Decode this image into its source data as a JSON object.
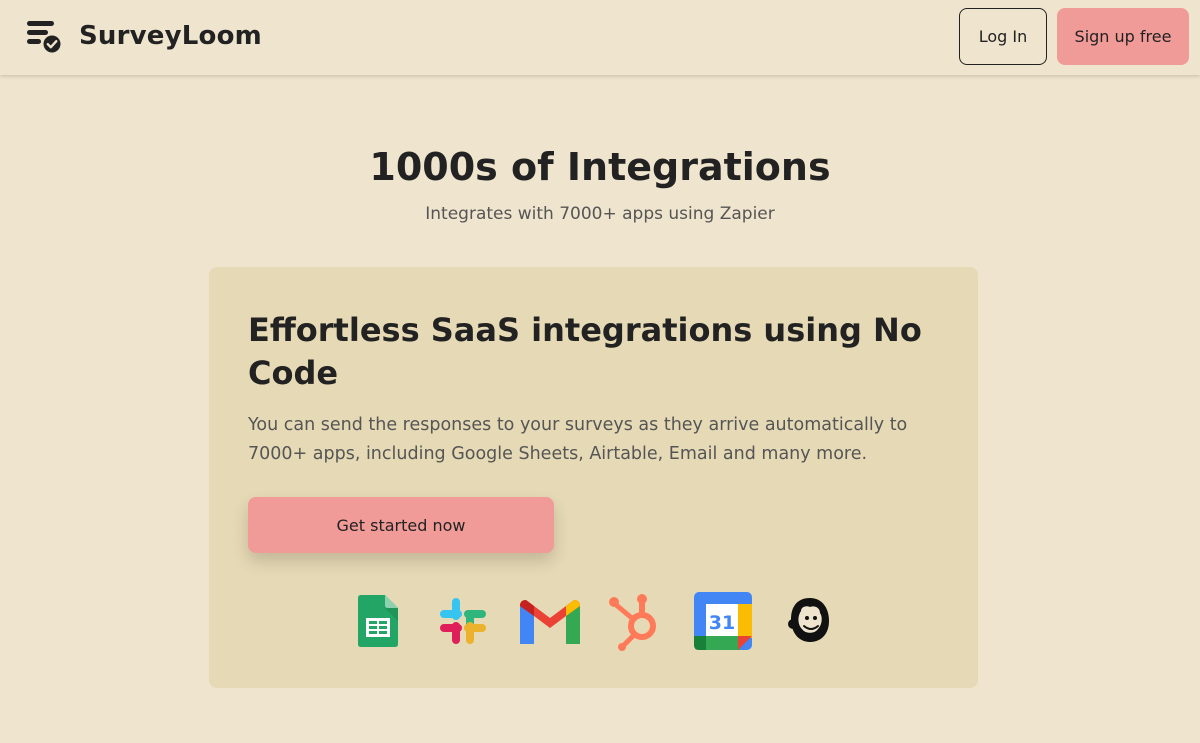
{
  "header": {
    "brand": "SurveyLoom",
    "logo_icon": "checklist-check-icon",
    "login_label": "Log In",
    "signup_label": "Sign up free"
  },
  "hero": {
    "title": "1000s of Integrations",
    "subtitle": "Integrates with 7000+ apps using Zapier"
  },
  "card": {
    "title": "Effortless SaaS integrations using No Code",
    "description": "You can send the responses to your surveys as they arrive automatically to 7000+ apps, including Google Sheets, Airtable, Email and many more.",
    "cta_label": "Get started now"
  },
  "integrations": [
    {
      "icon": "google-sheets-icon"
    },
    {
      "icon": "slack-icon"
    },
    {
      "icon": "gmail-icon"
    },
    {
      "icon": "hubspot-icon"
    },
    {
      "icon": "google-calendar-icon",
      "text": "31"
    },
    {
      "icon": "mailchimp-icon"
    }
  ],
  "colors": {
    "background": "#efe4cd",
    "card": "#e6d9b5",
    "accent": "#f09b97",
    "text": "#222222",
    "muted": "#555555"
  }
}
